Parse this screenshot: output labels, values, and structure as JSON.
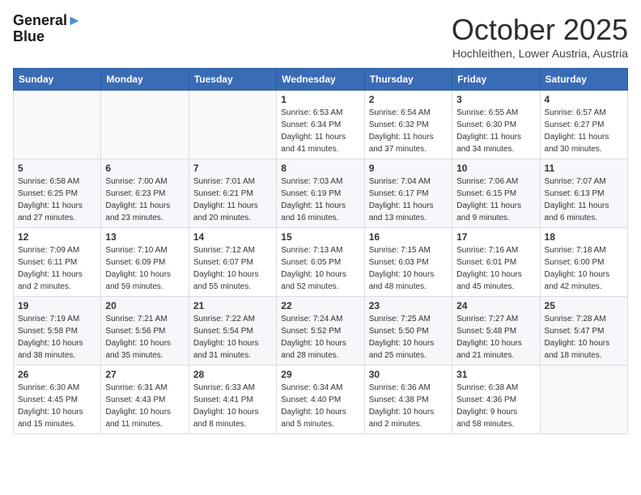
{
  "header": {
    "logo_line1": "General",
    "logo_line2": "Blue",
    "month": "October 2025",
    "location": "Hochleithen, Lower Austria, Austria"
  },
  "weekdays": [
    "Sunday",
    "Monday",
    "Tuesday",
    "Wednesday",
    "Thursday",
    "Friday",
    "Saturday"
  ],
  "weeks": [
    [
      {
        "day": "",
        "info": ""
      },
      {
        "day": "",
        "info": ""
      },
      {
        "day": "",
        "info": ""
      },
      {
        "day": "1",
        "info": "Sunrise: 6:53 AM\nSunset: 6:34 PM\nDaylight: 11 hours\nand 41 minutes."
      },
      {
        "day": "2",
        "info": "Sunrise: 6:54 AM\nSunset: 6:32 PM\nDaylight: 11 hours\nand 37 minutes."
      },
      {
        "day": "3",
        "info": "Sunrise: 6:55 AM\nSunset: 6:30 PM\nDaylight: 11 hours\nand 34 minutes."
      },
      {
        "day": "4",
        "info": "Sunrise: 6:57 AM\nSunset: 6:27 PM\nDaylight: 11 hours\nand 30 minutes."
      }
    ],
    [
      {
        "day": "5",
        "info": "Sunrise: 6:58 AM\nSunset: 6:25 PM\nDaylight: 11 hours\nand 27 minutes."
      },
      {
        "day": "6",
        "info": "Sunrise: 7:00 AM\nSunset: 6:23 PM\nDaylight: 11 hours\nand 23 minutes."
      },
      {
        "day": "7",
        "info": "Sunrise: 7:01 AM\nSunset: 6:21 PM\nDaylight: 11 hours\nand 20 minutes."
      },
      {
        "day": "8",
        "info": "Sunrise: 7:03 AM\nSunset: 6:19 PM\nDaylight: 11 hours\nand 16 minutes."
      },
      {
        "day": "9",
        "info": "Sunrise: 7:04 AM\nSunset: 6:17 PM\nDaylight: 11 hours\nand 13 minutes."
      },
      {
        "day": "10",
        "info": "Sunrise: 7:06 AM\nSunset: 6:15 PM\nDaylight: 11 hours\nand 9 minutes."
      },
      {
        "day": "11",
        "info": "Sunrise: 7:07 AM\nSunset: 6:13 PM\nDaylight: 11 hours\nand 6 minutes."
      }
    ],
    [
      {
        "day": "12",
        "info": "Sunrise: 7:09 AM\nSunset: 6:11 PM\nDaylight: 11 hours\nand 2 minutes."
      },
      {
        "day": "13",
        "info": "Sunrise: 7:10 AM\nSunset: 6:09 PM\nDaylight: 10 hours\nand 59 minutes."
      },
      {
        "day": "14",
        "info": "Sunrise: 7:12 AM\nSunset: 6:07 PM\nDaylight: 10 hours\nand 55 minutes."
      },
      {
        "day": "15",
        "info": "Sunrise: 7:13 AM\nSunset: 6:05 PM\nDaylight: 10 hours\nand 52 minutes."
      },
      {
        "day": "16",
        "info": "Sunrise: 7:15 AM\nSunset: 6:03 PM\nDaylight: 10 hours\nand 48 minutes."
      },
      {
        "day": "17",
        "info": "Sunrise: 7:16 AM\nSunset: 6:01 PM\nDaylight: 10 hours\nand 45 minutes."
      },
      {
        "day": "18",
        "info": "Sunrise: 7:18 AM\nSunset: 6:00 PM\nDaylight: 10 hours\nand 42 minutes."
      }
    ],
    [
      {
        "day": "19",
        "info": "Sunrise: 7:19 AM\nSunset: 5:58 PM\nDaylight: 10 hours\nand 38 minutes."
      },
      {
        "day": "20",
        "info": "Sunrise: 7:21 AM\nSunset: 5:56 PM\nDaylight: 10 hours\nand 35 minutes."
      },
      {
        "day": "21",
        "info": "Sunrise: 7:22 AM\nSunset: 5:54 PM\nDaylight: 10 hours\nand 31 minutes."
      },
      {
        "day": "22",
        "info": "Sunrise: 7:24 AM\nSunset: 5:52 PM\nDaylight: 10 hours\nand 28 minutes."
      },
      {
        "day": "23",
        "info": "Sunrise: 7:25 AM\nSunset: 5:50 PM\nDaylight: 10 hours\nand 25 minutes."
      },
      {
        "day": "24",
        "info": "Sunrise: 7:27 AM\nSunset: 5:48 PM\nDaylight: 10 hours\nand 21 minutes."
      },
      {
        "day": "25",
        "info": "Sunrise: 7:28 AM\nSunset: 5:47 PM\nDaylight: 10 hours\nand 18 minutes."
      }
    ],
    [
      {
        "day": "26",
        "info": "Sunrise: 6:30 AM\nSunset: 4:45 PM\nDaylight: 10 hours\nand 15 minutes."
      },
      {
        "day": "27",
        "info": "Sunrise: 6:31 AM\nSunset: 4:43 PM\nDaylight: 10 hours\nand 11 minutes."
      },
      {
        "day": "28",
        "info": "Sunrise: 6:33 AM\nSunset: 4:41 PM\nDaylight: 10 hours\nand 8 minutes."
      },
      {
        "day": "29",
        "info": "Sunrise: 6:34 AM\nSunset: 4:40 PM\nDaylight: 10 hours\nand 5 minutes."
      },
      {
        "day": "30",
        "info": "Sunrise: 6:36 AM\nSunset: 4:38 PM\nDaylight: 10 hours\nand 2 minutes."
      },
      {
        "day": "31",
        "info": "Sunrise: 6:38 AM\nSunset: 4:36 PM\nDaylight: 9 hours\nand 58 minutes."
      },
      {
        "day": "",
        "info": ""
      }
    ]
  ]
}
